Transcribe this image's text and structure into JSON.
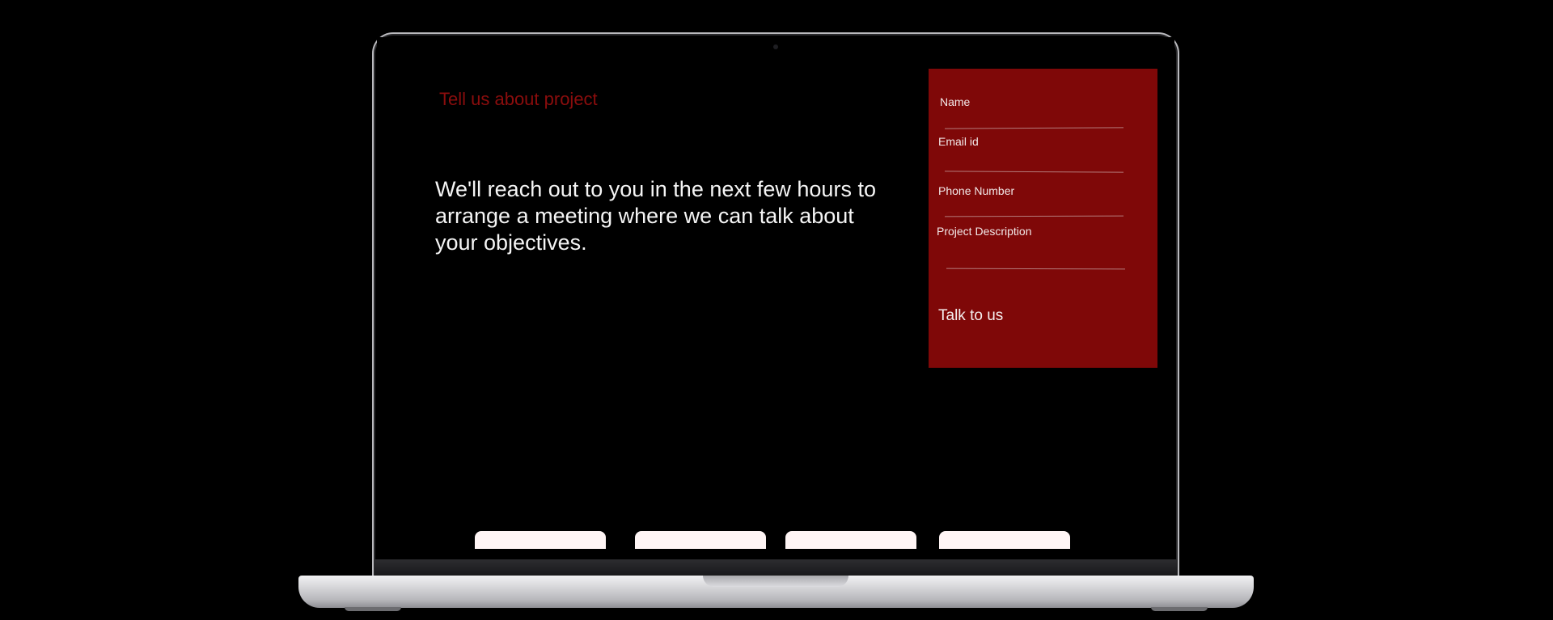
{
  "page": {
    "eyebrow": "Tell us about project",
    "lead": "We'll reach out to you in the next few hours to arrange a meeting where we can talk about your objectives."
  },
  "form": {
    "fields": [
      {
        "label": "Name",
        "value": ""
      },
      {
        "label": "Email id",
        "value": ""
      },
      {
        "label": "Phone Number",
        "value": ""
      },
      {
        "label": "Project Description",
        "value": ""
      }
    ],
    "submit_label": "Talk to us"
  },
  "colors": {
    "accent": "#8b0d0d",
    "panel": "#7f0808",
    "card": "#fff5f5"
  }
}
